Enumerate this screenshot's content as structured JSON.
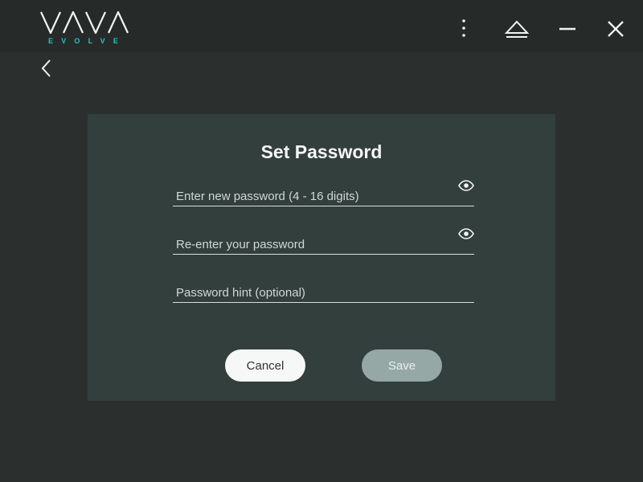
{
  "app": {
    "logo_main": "VAVA",
    "logo_sub": "EVOLVE",
    "accent_color": "#23c3c0"
  },
  "window_controls": {
    "more_icon": "more-vertical-icon",
    "eject_icon": "eject-icon",
    "minimize_icon": "minimize-icon",
    "close_icon": "close-icon"
  },
  "navigation": {
    "back_icon": "chevron-left-icon"
  },
  "dialog": {
    "title": "Set Password",
    "fields": {
      "new_password": {
        "placeholder": "Enter new password (4 - 16 digits)",
        "value": "",
        "icon": "eye-icon"
      },
      "confirm_password": {
        "placeholder": "Re-enter your password",
        "value": "",
        "icon": "eye-icon"
      },
      "hint": {
        "placeholder": "Password hint (optional)",
        "value": ""
      }
    },
    "buttons": {
      "cancel_label": "Cancel",
      "save_label": "Save"
    }
  }
}
